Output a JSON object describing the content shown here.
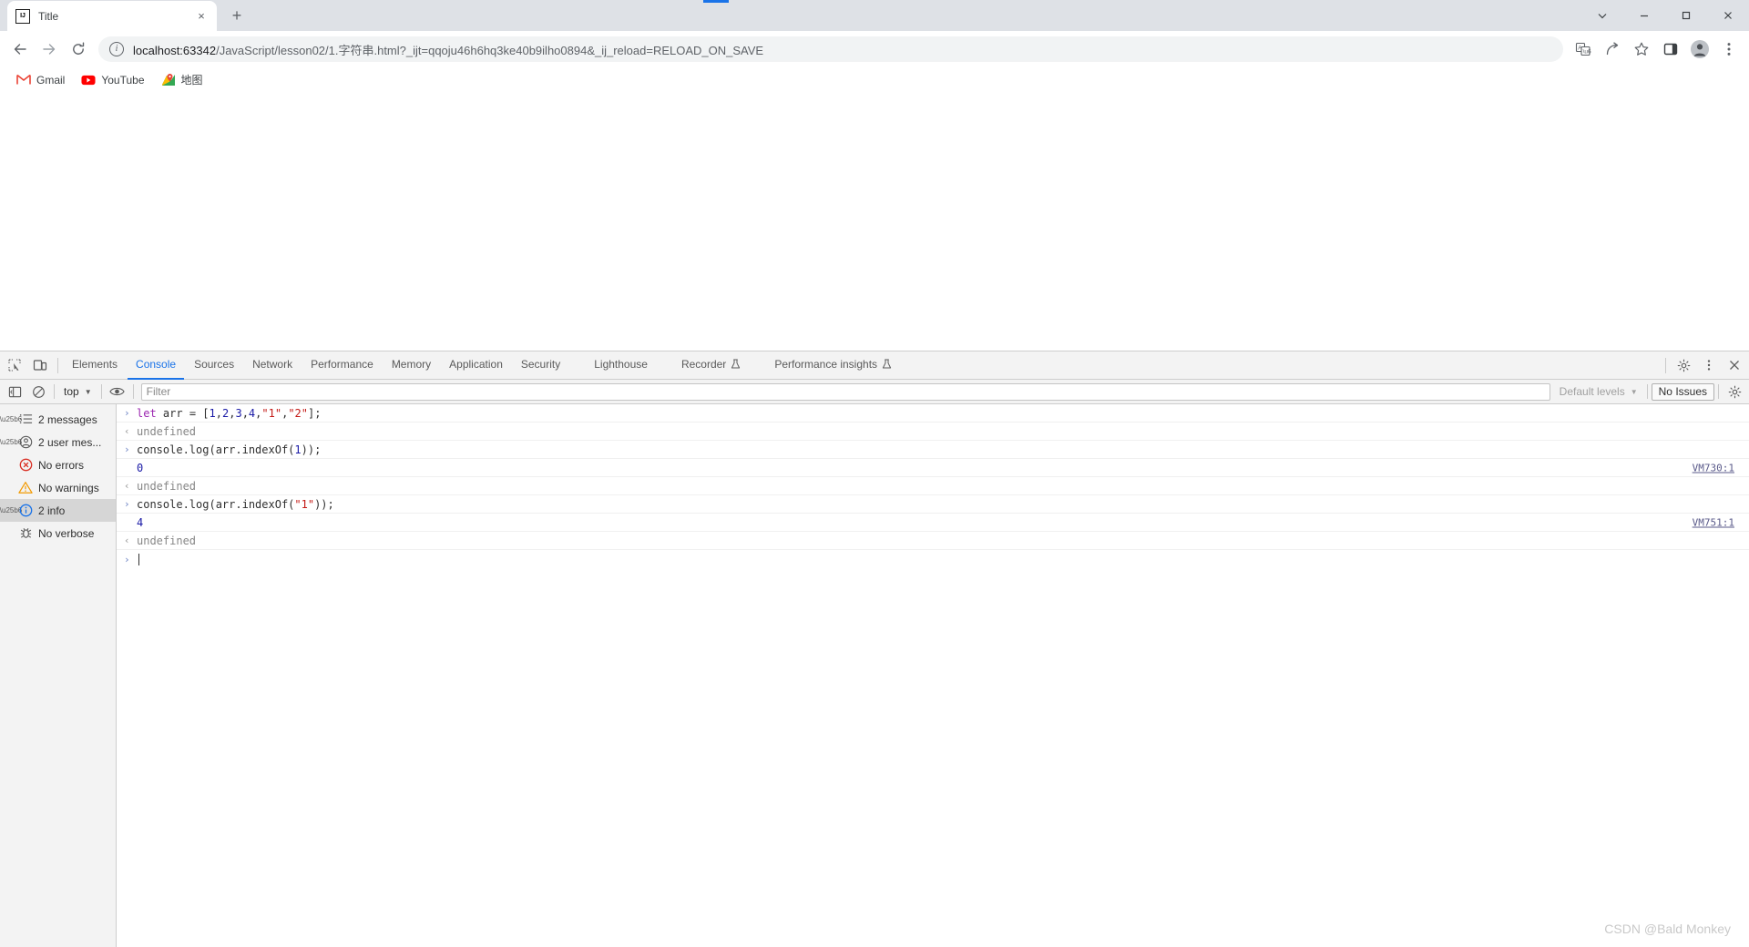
{
  "browser": {
    "tab": {
      "title": "Title",
      "favicon": "intellij-idea-icon",
      "close_label": "×"
    },
    "new_tab_label": "+",
    "window_controls": {
      "minimize": "—",
      "maximize": "☐",
      "close": "✕",
      "chevron": "⌄"
    },
    "nav": {
      "back": "back-arrow-icon",
      "forward": "forward-arrow-icon",
      "reload": "reload-icon"
    },
    "omnibox": {
      "info_glyph": "i",
      "url_host": "localhost:63342",
      "url_rest": "/JavaScript/lesson02/1.字符串.html?_ijt=qqoju46h6hq3ke40b9ilho0894&_ij_reload=RELOAD_ON_SAVE",
      "full_url": "localhost:63342/JavaScript/lesson02/1.字符串.html?_ijt=qqoju46h6hq3ke40b9ilho0894&_ij_reload=RELOAD_ON_SAVE"
    },
    "toolbar_icons": [
      "translate-icon",
      "share-icon",
      "star-icon",
      "side-panel-icon",
      "profile-avatar-icon",
      "more-menu-icon"
    ],
    "bookmarks": [
      {
        "label": "Gmail",
        "icon": "gmail-icon"
      },
      {
        "label": "YouTube",
        "icon": "youtube-icon"
      },
      {
        "label": "地图",
        "icon": "google-maps-icon"
      }
    ]
  },
  "devtools": {
    "left_icons": [
      "inspect-element-icon",
      "device-toolbar-icon"
    ],
    "tabs": [
      {
        "label": "Elements",
        "active": false,
        "flask": false
      },
      {
        "label": "Console",
        "active": true,
        "flask": false
      },
      {
        "label": "Sources",
        "active": false,
        "flask": false
      },
      {
        "label": "Network",
        "active": false,
        "flask": false
      },
      {
        "label": "Performance",
        "active": false,
        "flask": false
      },
      {
        "label": "Memory",
        "active": false,
        "flask": false
      },
      {
        "label": "Application",
        "active": false,
        "flask": false
      },
      {
        "label": "Security",
        "active": false,
        "flask": false
      },
      {
        "label": "Lighthouse",
        "active": false,
        "flask": false
      },
      {
        "label": "Recorder",
        "active": false,
        "flask": true
      },
      {
        "label": "Performance insights",
        "active": false,
        "flask": true
      }
    ],
    "right_icons": [
      "settings-gear-icon",
      "more-options-icon",
      "close-devtools-icon"
    ],
    "console_toolbar": {
      "sidebar_toggle": "console-sidebar-toggle-icon",
      "clear": "clear-console-icon",
      "context": "top",
      "context_caret": "▼",
      "eye": "live-expression-icon",
      "filter_placeholder": "Filter",
      "filter_value": "",
      "levels_label": "Default levels",
      "levels_caret": "▼",
      "issues_label": "No Issues",
      "settings": "console-settings-gear-icon"
    },
    "sidebar": [
      {
        "label": "2 messages",
        "icon": "message-list-icon",
        "expandable": true,
        "selected": false
      },
      {
        "label": "2 user mes...",
        "icon": "user-message-icon",
        "expandable": true,
        "selected": false
      },
      {
        "label": "No errors",
        "icon": "error-circle-icon",
        "expandable": false,
        "selected": false
      },
      {
        "label": "No warnings",
        "icon": "warning-triangle-icon",
        "expandable": false,
        "selected": false
      },
      {
        "label": "2 info",
        "icon": "info-circle-icon",
        "expandable": true,
        "selected": true
      },
      {
        "label": "No verbose",
        "icon": "verbose-bug-icon",
        "expandable": false,
        "selected": false
      }
    ],
    "console_rows": [
      {
        "kind": "input",
        "gutter": "›",
        "tokens": [
          {
            "t": "let",
            "c": "kw"
          },
          {
            "t": " ",
            "c": "p"
          },
          {
            "t": "arr",
            "c": "var"
          },
          {
            "t": " = [",
            "c": "p"
          },
          {
            "t": "1",
            "c": "num"
          },
          {
            "t": ",",
            "c": "p"
          },
          {
            "t": "2",
            "c": "num"
          },
          {
            "t": ",",
            "c": "p"
          },
          {
            "t": "3",
            "c": "num"
          },
          {
            "t": ",",
            "c": "p"
          },
          {
            "t": "4",
            "c": "num"
          },
          {
            "t": ",",
            "c": "p"
          },
          {
            "t": "\"1\"",
            "c": "str"
          },
          {
            "t": ",",
            "c": "p"
          },
          {
            "t": "\"2\"",
            "c": "str"
          },
          {
            "t": "];",
            "c": "p"
          }
        ],
        "plain": "let arr = [1,2,3,4,\"1\",\"2\"];",
        "vmlink": ""
      },
      {
        "kind": "result",
        "gutter": "‹",
        "plain": "undefined",
        "style": "muted",
        "vmlink": ""
      },
      {
        "kind": "input",
        "gutter": "›",
        "tokens": [
          {
            "t": "console.log(arr.indexOf(",
            "c": "p"
          },
          {
            "t": "1",
            "c": "num"
          },
          {
            "t": "));",
            "c": "p"
          }
        ],
        "plain": "console.log(arr.indexOf(1));",
        "vmlink": ""
      },
      {
        "kind": "log",
        "gutter": "",
        "plain": "0",
        "style": "num",
        "vmlink": "VM730:1"
      },
      {
        "kind": "result",
        "gutter": "‹",
        "plain": "undefined",
        "style": "muted",
        "vmlink": ""
      },
      {
        "kind": "input",
        "gutter": "›",
        "tokens": [
          {
            "t": "console.log(arr.indexOf(",
            "c": "p"
          },
          {
            "t": "\"1\"",
            "c": "str"
          },
          {
            "t": "));",
            "c": "p"
          }
        ],
        "plain": "console.log(arr.indexOf(\"1\"));",
        "vmlink": ""
      },
      {
        "kind": "log",
        "gutter": "",
        "plain": "4",
        "style": "num",
        "vmlink": "VM751:1"
      },
      {
        "kind": "result",
        "gutter": "‹",
        "plain": "undefined",
        "style": "muted",
        "vmlink": ""
      },
      {
        "kind": "prompt",
        "gutter": "›",
        "plain": "",
        "style": "",
        "vmlink": ""
      }
    ]
  },
  "watermark": "CSDN @Bald Monkey",
  "colors": {
    "accent": "#1a73e8",
    "chrome_tabstrip": "#dee1e6",
    "devtools_bg": "#f3f3f3",
    "keyword": "#9c27b0",
    "number": "#1a1aa6",
    "string": "#c41a16",
    "error_red": "#d93025",
    "warning_orange": "#f29900",
    "info_blue": "#1a73e8"
  }
}
